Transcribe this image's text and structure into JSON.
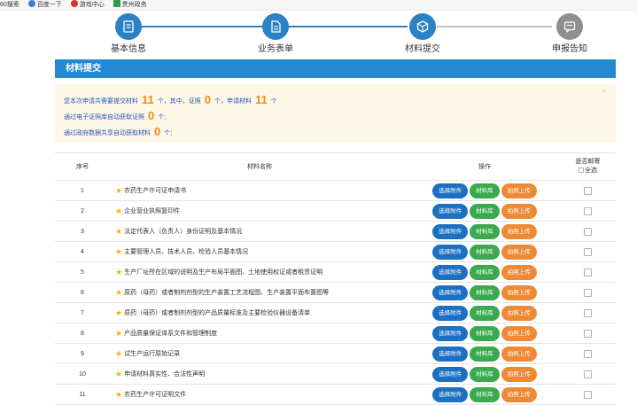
{
  "bookmarks": [
    {
      "label": "60搜索",
      "icon": "none"
    },
    {
      "label": "百度一下",
      "icon": "paw-icon"
    },
    {
      "label": "游戏中心",
      "icon": "game-icon"
    },
    {
      "label": "贵州政务",
      "icon": "gov-icon"
    }
  ],
  "steps": [
    {
      "label": "基本信息",
      "state": "done",
      "icon": "form-icon"
    },
    {
      "label": "业务表单",
      "state": "done",
      "icon": "document-icon"
    },
    {
      "label": "材料提交",
      "state": "done",
      "icon": "box-icon"
    },
    {
      "label": "申报告知",
      "state": "todo",
      "icon": "message-icon"
    }
  ],
  "panel": {
    "title": "材料提交"
  },
  "notice": {
    "line1_prefix": "您本次申请共需要提交材料",
    "total": "11",
    "line1_mid1": "个，其中，证照",
    "license_count": "0",
    "line1_mid2": "个，申请材料",
    "material_count": "11",
    "line1_suffix": "个",
    "line2_prefix": "通过电子证照库自动获取证照",
    "auto_license": "0",
    "line2_suffix": "个;",
    "line3_prefix": "通过政府数据共享自动获取材料",
    "auto_material": "0",
    "line3_suffix": "个;",
    "close_symbol": "×"
  },
  "table": {
    "headers": {
      "seq": "序号",
      "name": "材料名称",
      "op": "操作",
      "mail": "是否邮寄",
      "select_all": "全选"
    },
    "buttons": {
      "select": "选择附件",
      "lib": "材料库",
      "photo": "拍照上传"
    },
    "rows": [
      {
        "seq": "1",
        "name": "农药生产许可证申请书"
      },
      {
        "seq": "2",
        "name": "企业营业执照复印件"
      },
      {
        "seq": "3",
        "name": "法定代表人（负责人）身份证明及基本情况"
      },
      {
        "seq": "4",
        "name": "主要管理人员、技术人员、检验人员基本情况"
      },
      {
        "seq": "5",
        "name": "生产厂址所在区域的说明及生产布局平面图、土地使用权证或者租赁证明"
      },
      {
        "seq": "6",
        "name": "原药（母药）或者制剂剂型的生产装置工艺流程图、生产装置平面布置图等"
      },
      {
        "seq": "7",
        "name": "原药（母药）或者制剂剂型的产品质量标准及主要检验仪器设备清单"
      },
      {
        "seq": "8",
        "name": "产品质量保证体系文件和管理制度"
      },
      {
        "seq": "9",
        "name": "试生产运行原始记录"
      },
      {
        "seq": "10",
        "name": "申请材料真实性、合法性声明"
      },
      {
        "seq": "11",
        "name": "农药生产许可证明文件"
      }
    ]
  }
}
